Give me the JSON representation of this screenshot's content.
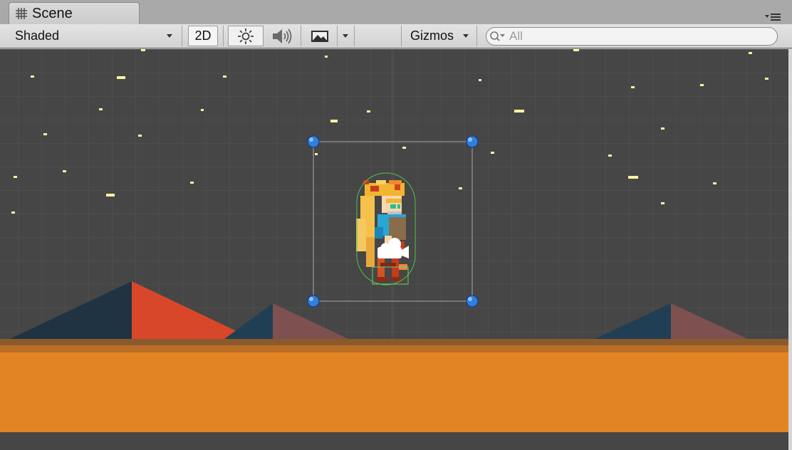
{
  "window": {
    "tab_title": "Scene",
    "tab_icon": "grid-hash-icon",
    "menu_icon": "tab-menu-icon"
  },
  "toolbar": {
    "shading_mode": "Shaded",
    "mode_2d_label": "2D",
    "lighting_icon": "sun-icon",
    "audio_icon": "speaker-icon",
    "effects_icon": "image-icon",
    "gizmos_label": "Gizmos",
    "search": {
      "value": "",
      "placeholder": "All",
      "icon": "search-icon"
    }
  },
  "scene": {
    "background_color": "#464646",
    "ground_color": "#e38424",
    "ground_top_color": "#8b5a2c",
    "ground_stripe_color": "#b96d26",
    "mountain_colors": {
      "large_shadow": "#1f3342",
      "large_lit": "#d9472a",
      "small_shadow": "#203f54",
      "small_lit": "#7e5050"
    },
    "character": "pixel-art-girl-sprite",
    "camera_icon": "camera-gizmo-icon",
    "selection_handle_color": "#2f7ee0",
    "collider_color": "#52c24a",
    "star_color": "#f7f3a0"
  }
}
